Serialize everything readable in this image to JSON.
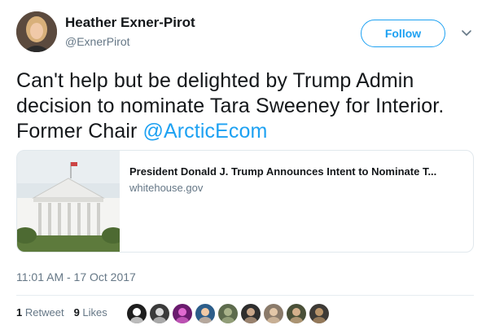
{
  "author": {
    "name": "Heather Exner-Pirot",
    "handle": "@ExnerPirot",
    "avatar_icon": "profile-photo"
  },
  "follow_label": "Follow",
  "menu_icon": "chevron-down-icon",
  "tweet": {
    "text": "Can't help but be delighted by Trump Admin decision to nominate Tara Sweeney for Interior. Former Chair ",
    "mention": "@ArcticEcom"
  },
  "card": {
    "title": "President Donald J. Trump Announces Intent to Nominate T...",
    "domain": "whitehouse.gov",
    "image_icon": "white-house-photo"
  },
  "timestamp": "11:01 AM - 17 Oct 2017",
  "stats": {
    "retweets_count": "1",
    "retweets_label": "Retweet",
    "likes_count": "9",
    "likes_label": "Likes"
  },
  "colors": {
    "accent": "#1da1f2",
    "text": "#14171a",
    "secondary": "#657786",
    "border": "#e1e8ed"
  },
  "likers": [
    {
      "icon": "arctic-watch-avatar",
      "bg": "#1e1e1e",
      "fg": "#ffffff"
    },
    {
      "icon": "bw-portrait-avatar",
      "bg": "#3a3a3a",
      "fg": "#d9d9d9"
    },
    {
      "icon": "magenta-avatar",
      "bg": "#6a1b6e",
      "fg": "#e06ad0"
    },
    {
      "icon": "blue-portrait-avatar",
      "bg": "#2c5d8a",
      "fg": "#f1c9a5"
    },
    {
      "icon": "field-avatar",
      "bg": "#5d6b4d",
      "fg": "#a9b38a"
    },
    {
      "icon": "man-portrait-avatar",
      "bg": "#2e2e2e",
      "fg": "#c8a68a"
    },
    {
      "icon": "glasses-portrait-avatar",
      "bg": "#8a7a6a",
      "fg": "#e3c7a8"
    },
    {
      "icon": "bearded-avatar",
      "bg": "#4a5038",
      "fg": "#d4b08c"
    },
    {
      "icon": "book-avatar",
      "bg": "#3d3a36",
      "fg": "#b9946a"
    }
  ]
}
